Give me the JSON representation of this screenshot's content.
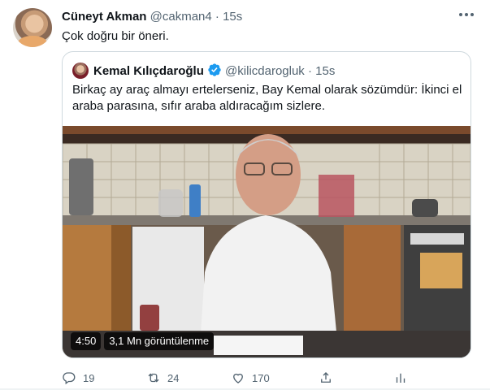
{
  "tweet": {
    "author_name": "Cüneyt Akman",
    "author_handle": "@cakman4",
    "separator": "·",
    "time": "15s",
    "text": "Çok doğru bir öneri."
  },
  "quoted": {
    "author_name": "Kemal Kılıçdaroğlu",
    "author_handle": "@kilicdarogluk",
    "separator": "·",
    "time": "15s",
    "text_line1": "Birkaç ay araç almayı ertelerseniz, Bay Kemal olarak sözümdür: İkinci el",
    "text_line2": "araba parasına, sıfır araba aldıracağım sizlere.",
    "video_duration": "4:50",
    "video_views": "3,1 Mn görüntülenme"
  },
  "actions": {
    "reply_count": "19",
    "retweet_count": "24",
    "like_count": "170"
  },
  "icons": {
    "more": "more-icon",
    "verified": "verified-badge-icon",
    "reply": "reply-icon",
    "retweet": "retweet-icon",
    "like": "heart-icon",
    "share": "share-icon",
    "analytics": "analytics-icon"
  },
  "colors": {
    "verified_blue": "#1d9bf0",
    "muted_text": "#536471",
    "border": "#cfd9de"
  }
}
